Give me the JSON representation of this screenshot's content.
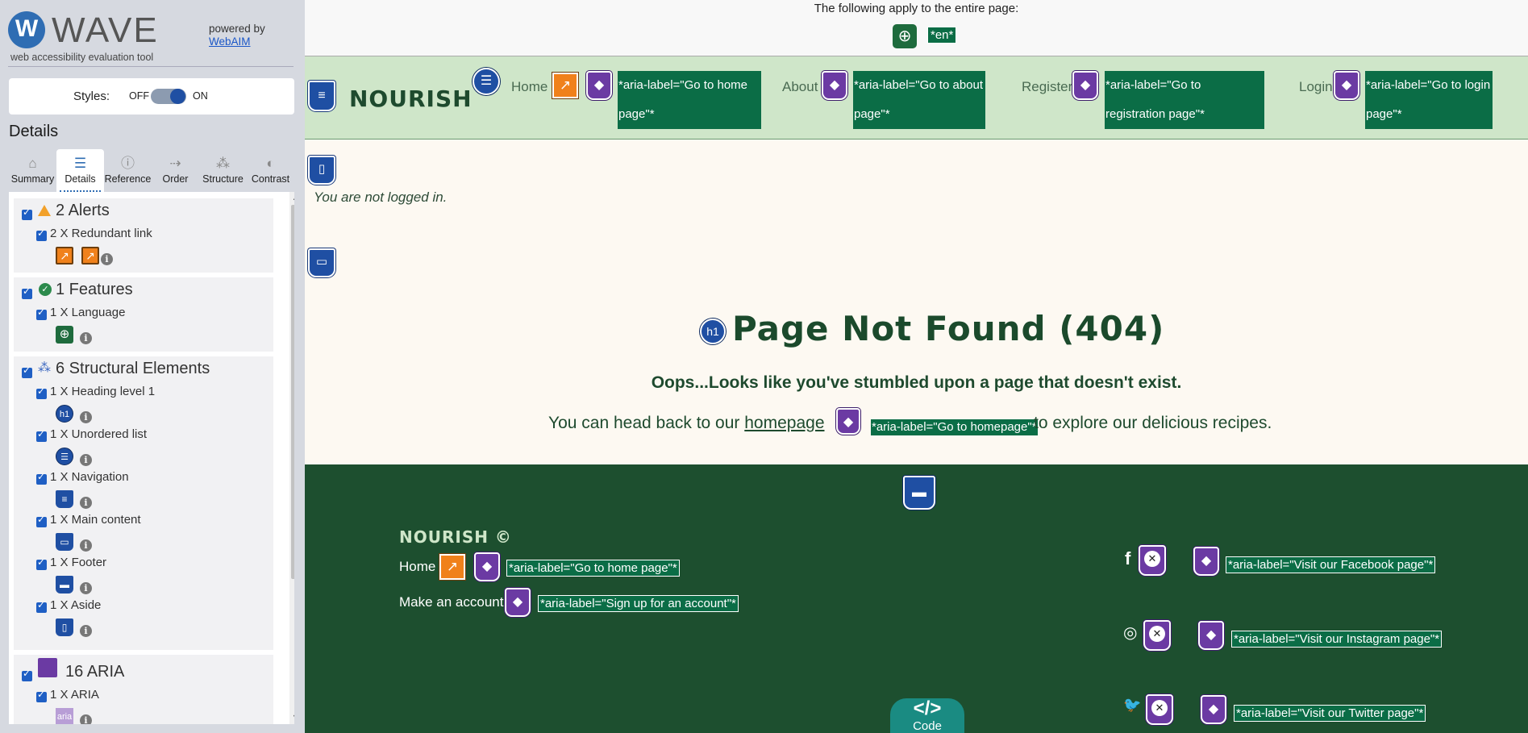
{
  "wave": {
    "logo_letter": "W",
    "logo_name": "WAVE",
    "logo_subtitle": "web accessibility evaluation tool",
    "powered_by": "powered by",
    "webaim_link": "WebAIM",
    "styles_label": "Styles:",
    "styles_off": "OFF",
    "styles_on": "ON",
    "details_heading": "Details",
    "tabs": [
      {
        "label": "Summary",
        "icon": "home-icon",
        "glyph": "⌂"
      },
      {
        "label": "Details",
        "icon": "list-icon",
        "glyph": "☰"
      },
      {
        "label": "Reference",
        "icon": "info-icon",
        "glyph": "ⓘ"
      },
      {
        "label": "Order",
        "icon": "order-icon",
        "glyph": "⇢"
      },
      {
        "label": "Structure",
        "icon": "structure-icon",
        "glyph": "⁂"
      },
      {
        "label": "Contrast",
        "icon": "contrast-icon",
        "glyph": "◐"
      }
    ],
    "categories": {
      "alerts": {
        "title": "2 Alerts",
        "items": [
          "2 X Redundant link"
        ]
      },
      "features": {
        "title": "1 Features",
        "items": [
          "1 X Language"
        ]
      },
      "structural": {
        "title": "6 Structural Elements",
        "items": [
          "1 X Heading level 1",
          "1 X Unordered list",
          "1 X Navigation",
          "1 X Main content",
          "1 X Footer",
          "1 X Aside"
        ]
      },
      "aria": {
        "title": "16 ARIA",
        "items": [
          "1 X ARIA"
        ]
      }
    },
    "icon_labels": {
      "h1": "h1",
      "aria": "aria",
      "info": "i"
    }
  },
  "page": {
    "apply_text": "The following apply to the entire page:",
    "lang_tag": "*en*",
    "brand": "NOURISH",
    "nav": [
      {
        "label": "Home",
        "aria": "*aria-label=\"Go to home page\"*"
      },
      {
        "label": "About",
        "aria": "*aria-label=\"Go to about page\"*"
      },
      {
        "label": "Register",
        "aria": "*aria-label=\"Go to registration page\"*"
      },
      {
        "label": "Login",
        "aria": "*aria-label=\"Go to login page\"*"
      }
    ],
    "not_logged_in": "You are not logged in.",
    "heading": "Page Not Found (404)",
    "oops": "Oops...Looks like you've stumbled upon a page that doesn't exist.",
    "head_back_before": "You can head back to our ",
    "homepage_link": "homepage",
    "homepage_aria": "*aria-label=\"Go to homepage\"*",
    "head_back_after": " to explore our delicious recipes.",
    "footer": {
      "brand": "NOURISH ©",
      "home": "Home",
      "home_aria": "*aria-label=\"Go to home page\"*",
      "account": "Make an account",
      "account_aria": "*aria-label=\"Sign up for an account\"*",
      "social": [
        {
          "icon": "facebook-icon",
          "glyph": "f",
          "aria": "*aria-label=\"Visit our Facebook page\"*"
        },
        {
          "icon": "instagram-icon",
          "glyph": "◎",
          "aria": "*aria-label=\"Visit our Instagram page\"*"
        },
        {
          "icon": "twitter-icon",
          "glyph": "🐦",
          "aria": "*aria-label=\"Visit our Twitter page\"*"
        }
      ]
    },
    "code_glyph": "</>",
    "code_label": "Code"
  },
  "colors": {
    "nav_bg": "#cfe6c9",
    "footer_bg": "#1d4f2f",
    "aria_label_bg": "#0b6d46",
    "structure_blue": "#1f4fa3",
    "aria_purple": "#6b3aa3",
    "alert_orange": "#f0811b"
  }
}
